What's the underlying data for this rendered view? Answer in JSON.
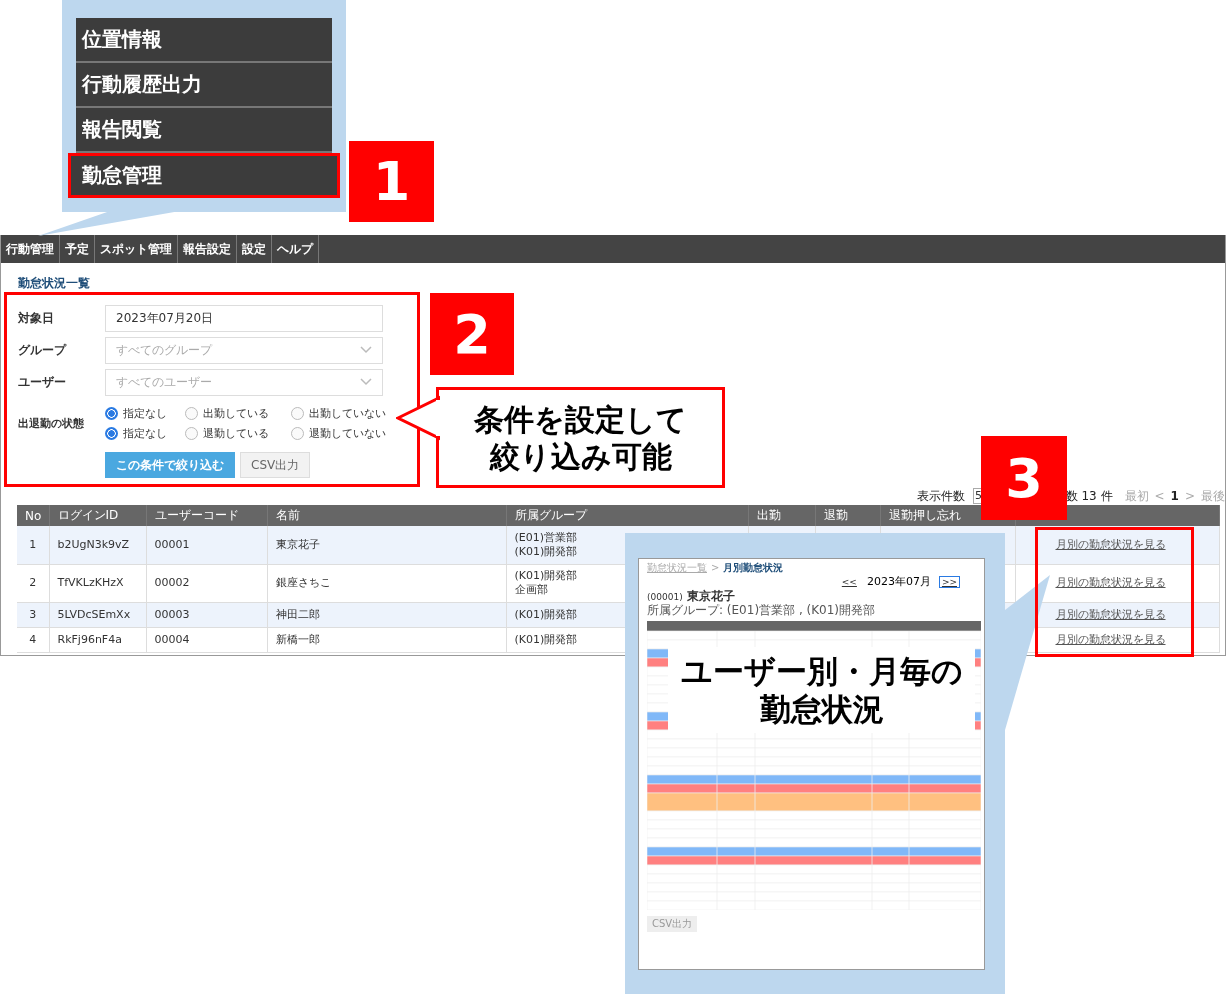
{
  "menu_callout": {
    "step": "1",
    "items": [
      {
        "label": "位置情報",
        "selected": false
      },
      {
        "label": "行動履歴出力",
        "selected": false
      },
      {
        "label": "報告閲覧",
        "selected": false
      },
      {
        "label": "勤怠管理",
        "selected": true
      }
    ]
  },
  "nav": [
    "行動管理",
    "予定",
    "スポット管理",
    "報告設定",
    "設定",
    "ヘルプ"
  ],
  "page_title": "勤怠状況一覧",
  "filter": {
    "step": "2",
    "note": "条件を設定して絞り込み可能",
    "fields": [
      {
        "label": "対象日",
        "kind": "text",
        "value": "2023年07月20日"
      },
      {
        "label": "グループ",
        "kind": "select",
        "placeholder": "すべてのグループ"
      },
      {
        "label": "ユーザー",
        "kind": "select",
        "placeholder": "すべてのユーザー"
      }
    ],
    "status": {
      "label": "出退勤の状態",
      "groups": [
        {
          "options": [
            {
              "label": "指定なし",
              "selected": true
            },
            {
              "label": "出勤している",
              "selected": false
            },
            {
              "label": "出勤していない",
              "selected": false
            }
          ]
        },
        {
          "options": [
            {
              "label": "指定なし",
              "selected": true
            },
            {
              "label": "退勤している",
              "selected": false
            },
            {
              "label": "退勤していない",
              "selected": false
            }
          ]
        }
      ]
    },
    "buttons": [
      {
        "label": "この条件で絞り込む",
        "kind": "primary"
      },
      {
        "label": "CSV出力",
        "kind": "secondary"
      }
    ]
  },
  "pager": {
    "per_page_label": "表示件数",
    "per_page": "5",
    "total": "数 13 件",
    "first": "最初",
    "prev": "<",
    "page": "1",
    "next": ">",
    "last": "最後"
  },
  "table": {
    "step": "3",
    "columns": [
      "No",
      "ログインID",
      "ユーザーコード",
      "名前",
      "所属グループ",
      "出勤",
      "退勤",
      "退勤押し忘れ"
    ],
    "rows": [
      {
        "no": "1",
        "login_id": "b2UgN3k9vZ",
        "user_code": "00001",
        "name": "東京花子",
        "groups": [
          "(E01)営業部",
          "(K01)開発部"
        ],
        "link": "月別の勤怠状況を見る"
      },
      {
        "no": "2",
        "login_id": "TfVKLzKHzX",
        "user_code": "00002",
        "name": "銀座さちこ",
        "groups": [
          "(K01)開発部",
          "企画部"
        ],
        "link": "月別の勤怠状況を見る"
      },
      {
        "no": "3",
        "login_id": "5LVDcSEmXx",
        "user_code": "00003",
        "name": "神田二郎",
        "groups": [
          "(K01)開発部"
        ],
        "link": "月別の勤怠状況を見る"
      },
      {
        "no": "4",
        "login_id": "RkFj96nF4a",
        "user_code": "00004",
        "name": "新橋一郎",
        "groups": [
          "(K01)開発部"
        ],
        "link": "月別の勤怠状況を見る"
      }
    ]
  },
  "preview": {
    "breadcrumb": [
      "勤怠状況一覧",
      "月別勤怠状況"
    ],
    "separator": ">",
    "prev": "<<",
    "month": "2023年07月",
    "next": ">>",
    "user_code": "(00001)",
    "user_name": "東京花子",
    "group_line": "所属グループ: (E01)営業部 , (K01)開発部",
    "day_rows": [
      {
        "kind": "weekday"
      },
      {
        "kind": "weekday"
      },
      {
        "kind": "saturday"
      },
      {
        "kind": "sunday"
      },
      {
        "kind": "weekday"
      },
      {
        "kind": "weekday"
      },
      {
        "kind": "weekday"
      },
      {
        "kind": "weekday"
      },
      {
        "kind": "weekday"
      },
      {
        "kind": "saturday"
      },
      {
        "kind": "sunday"
      },
      {
        "kind": "weekday"
      },
      {
        "kind": "weekday"
      },
      {
        "kind": "weekday"
      },
      {
        "kind": "weekday"
      },
      {
        "kind": "weekday"
      },
      {
        "kind": "saturday"
      },
      {
        "kind": "sunday"
      },
      {
        "kind": "holiday"
      },
      {
        "kind": "weekday"
      },
      {
        "kind": "weekday"
      },
      {
        "kind": "weekday"
      },
      {
        "kind": "weekday"
      },
      {
        "kind": "saturday"
      },
      {
        "kind": "sunday"
      },
      {
        "kind": "weekday"
      },
      {
        "kind": "weekday"
      },
      {
        "kind": "weekday"
      },
      {
        "kind": "weekday"
      },
      {
        "kind": "weekday"
      }
    ],
    "csv_button": "CSV出力",
    "caption": "ユーザー別・月毎の勤怠状況"
  }
}
